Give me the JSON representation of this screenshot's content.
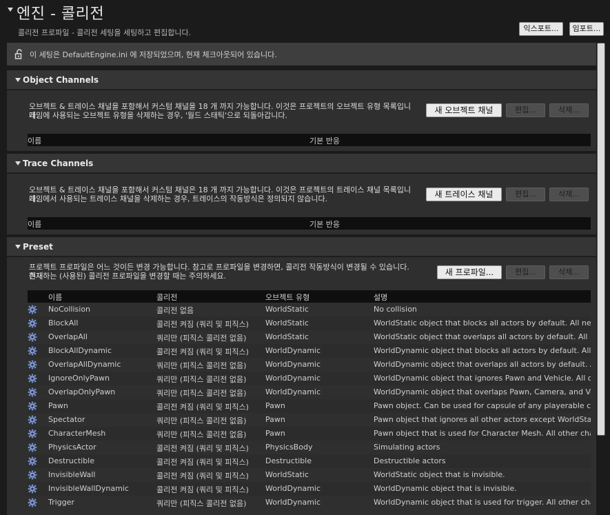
{
  "page": {
    "title": "엔진 - 콜리전",
    "subtitle": "콜리전 프로파일 - 콜리전 세팅을 세팅하고 편집합니다.",
    "export_label": "익스포트...",
    "import_label": "임포트..."
  },
  "banner": {
    "text": "이 세팅은 DefaultEngine.ini 에 저장되었으며, 현재 체크아웃되어 있습니다."
  },
  "object_channels": {
    "title": "Object Channels",
    "desc_line1": "오브젝트 & 트레이스 채널을 포함해서 커스텀 채널을 18 개 까지 가능합니다. 이것은 프로젝트의 오브젝트 유형 목록입니다.",
    "desc_line2": "게임에 사용되는 오브젝트 유형을 삭제하는 경우, '월드 스태틱'으로 되돌아갑니다.",
    "new_label": "새 오브젝트 채널",
    "edit_label": "편집...",
    "delete_label": "삭제...",
    "col_name": "이름",
    "col_default": "기본 반응"
  },
  "trace_channels": {
    "title": "Trace Channels",
    "desc_line1": "오브젝트 & 트레이스 채널을 포함해서 커스텀 채널은 18 개 까지 가능합니다. 이것은 프로젝트의 트레이스 채널 목록입니다.",
    "desc_line2": "게임에서 사용되는 트레이스 채널을 삭제하는 경우, 트레이스의 작동방식은 정의되지 않습니다.",
    "new_label": "새 트레이스 채널",
    "edit_label": "편집...",
    "delete_label": "삭제...",
    "col_name": "이름",
    "col_default": "기본 반응"
  },
  "preset": {
    "title": "Preset",
    "desc_line1": "프로젝트 프로파일은 어느 것이든 변경 가능합니다. 참고로 프로파일을 변경하면, 콜리전 작동방식이 변경될 수 있습니다. 현재",
    "desc_line2": "존재하는 (사용된) 콜리전 프로파일을 변경할 때는 주의하세요.",
    "new_label": "새 프로파일...",
    "edit_label": "편집...",
    "delete_label": "삭제...",
    "columns": [
      "이름",
      "콜리전",
      "오브젝트 유형",
      "설명"
    ],
    "rows": [
      {
        "name": "NoCollision",
        "collision": "콜리전 없음",
        "type": "WorldStatic",
        "desc": "No collision"
      },
      {
        "name": "BlockAll",
        "collision": "콜리전 켜짐 (쿼리 및 피직스)",
        "type": "WorldStatic",
        "desc": "WorldStatic object that blocks all actors by default. All new cus"
      },
      {
        "name": "OverlapAll",
        "collision": "쿼리만 (피직스 콜리전 없음)",
        "type": "WorldStatic",
        "desc": "WorldStatic object that overlaps all actors by default. All new c"
      },
      {
        "name": "BlockAllDynamic",
        "collision": "콜리전 켜짐 (쿼리 및 피직스)",
        "type": "WorldDynamic",
        "desc": "WorldDynamic object that blocks all actors by default. All new c"
      },
      {
        "name": "OverlapAllDynamic",
        "collision": "쿼리만 (피직스 콜리전 없음)",
        "type": "WorldDynamic",
        "desc": "WorldDynamic object that overlaps all actors by default. All nev"
      },
      {
        "name": "IgnoreOnlyPawn",
        "collision": "쿼리만 (피직스 콜리전 없음)",
        "type": "WorldDynamic",
        "desc": "WorldDynamic object that ignores Pawn and Vehicle. All other c"
      },
      {
        "name": "OverlapOnlyPawn",
        "collision": "쿼리만 (피직스 콜리전 없음)",
        "type": "WorldDynamic",
        "desc": "WorldDynamic object that overlaps Pawn, Camera, and Vehicle."
      },
      {
        "name": "Pawn",
        "collision": "콜리전 켜짐 (쿼리 및 피직스)",
        "type": "Pawn",
        "desc": "Pawn object. Can be used for capsule of any playerable charact"
      },
      {
        "name": "Spectator",
        "collision": "쿼리만 (피직스 콜리전 없음)",
        "type": "Pawn",
        "desc": "Pawn object that ignores all other actors except WorldStatic."
      },
      {
        "name": "CharacterMesh",
        "collision": "쿼리만 (피직스 콜리전 없음)",
        "type": "Pawn",
        "desc": "Pawn object that is used for Character Mesh. All other channels"
      },
      {
        "name": "PhysicsActor",
        "collision": "콜리전 켜짐 (쿼리 및 피직스)",
        "type": "PhysicsBody",
        "desc": "Simulating actors"
      },
      {
        "name": "Destructible",
        "collision": "콜리전 켜짐 (쿼리 및 피직스)",
        "type": "Destructible",
        "desc": "Destructible actors"
      },
      {
        "name": "InvisibleWall",
        "collision": "콜리전 켜짐 (쿼리 및 피직스)",
        "type": "WorldStatic",
        "desc": "WorldStatic object that is invisible."
      },
      {
        "name": "InvisibleWallDynamic",
        "collision": "콜리전 켜짐 (쿼리 및 피직스)",
        "type": "WorldDynamic",
        "desc": "WorldDynamic object that is invisible."
      },
      {
        "name": "Trigger",
        "collision": "쿼리만 (피직스 콜리전 없음)",
        "type": "WorldDynamic",
        "desc": "WorldDynamic object that is used for trigger. All other channels"
      }
    ]
  }
}
